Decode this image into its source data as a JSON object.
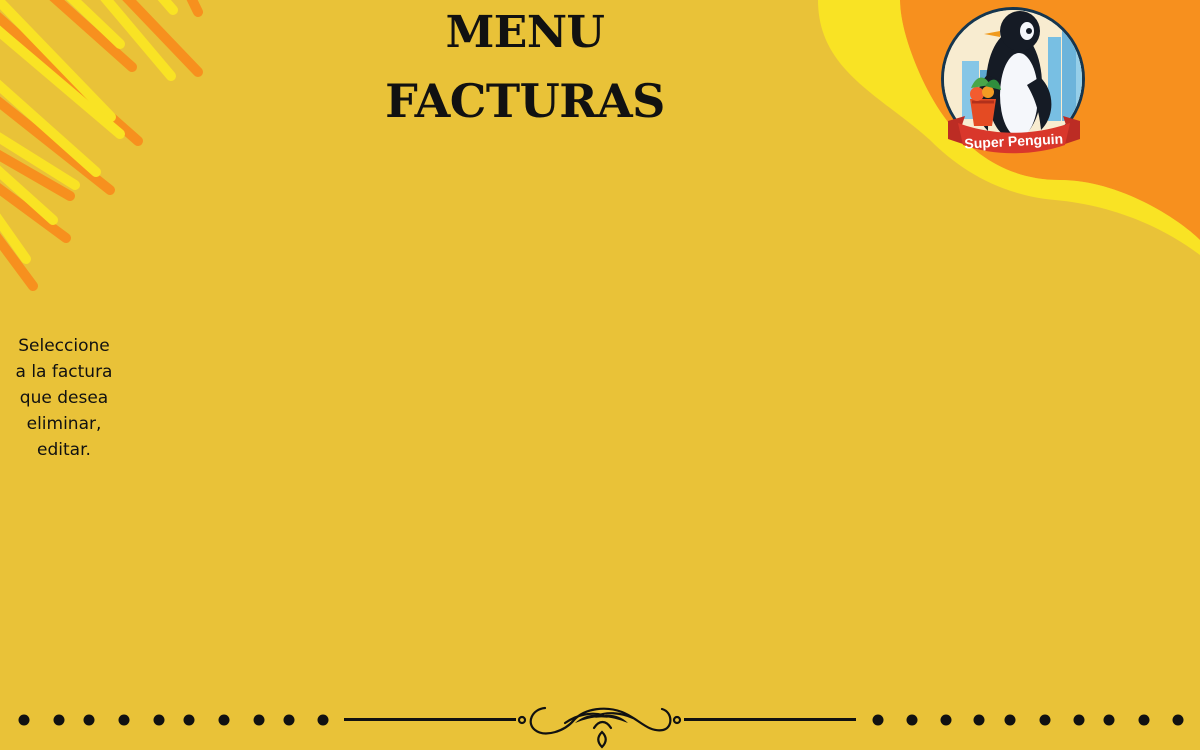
{
  "page": {
    "title_line1": "MENU",
    "title_line2": "FACTURAS",
    "instruction_lines": [
      "Seleccione",
      "a la factura",
      "que desea",
      "eliminar,",
      "editar."
    ]
  },
  "logo": {
    "brand_name": "Super Penguin",
    "icon": "penguin-logo"
  },
  "colors": {
    "background": "#e9c238",
    "orange_accent": "#f7901e",
    "yellow_accent": "#f9e324",
    "ink": "#111111"
  }
}
